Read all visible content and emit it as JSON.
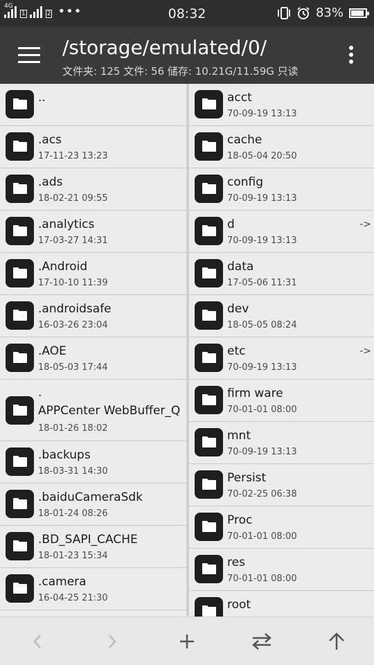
{
  "status_bar": {
    "network": "4G",
    "sim1": "1",
    "sim2": "2",
    "more": "•••",
    "time": "08:32",
    "battery": "83%",
    "battery_level": 0.83
  },
  "app_bar": {
    "title": "/storage/emulated/0/",
    "subtitle": "文件夹: 125  文件: 56  储存: 10.21G/11.59G  只读"
  },
  "left_pane": [
    {
      "name": "..",
      "date": ""
    },
    {
      "name": ".acs",
      "date": "17-11-23 13:23"
    },
    {
      "name": ".ads",
      "date": "18-02-21 09:55"
    },
    {
      "name": ".analytics",
      "date": "17-03-27 14:31"
    },
    {
      "name": ".Android",
      "date": "17-10-10 11:39"
    },
    {
      "name": ".androidsafe",
      "date": "16-03-26 23:04"
    },
    {
      "name": ".AOE",
      "date": "18-05-03 17:44"
    },
    {
      "name": ".\nAPPCenter WebBuffer_Q",
      "date": "18-01-26 18:02"
    },
    {
      "name": ".backups",
      "date": "18-03-31 14:30"
    },
    {
      "name": ".baiduCameraSdk",
      "date": "18-01-24 08:26"
    },
    {
      "name": ".BD_SAPI_CACHE",
      "date": "18-01-23 15:34"
    },
    {
      "name": ".camera",
      "date": "16-04-25 21:30"
    }
  ],
  "right_pane": [
    {
      "name": "acct",
      "date": "70-09-19 13:13",
      "link": ""
    },
    {
      "name": "cache",
      "date": "18-05-04 20:50",
      "link": ""
    },
    {
      "name": "config",
      "date": "70-09-19 13:13",
      "link": ""
    },
    {
      "name": "d",
      "date": "70-09-19 13:13",
      "link": "->"
    },
    {
      "name": "data",
      "date": "17-05-06 11:31",
      "link": ""
    },
    {
      "name": "dev",
      "date": "18-05-05 08:24",
      "link": ""
    },
    {
      "name": "etc",
      "date": "70-09-19 13:13",
      "link": "->"
    },
    {
      "name": "firm ware",
      "date": "70-01-01 08:00",
      "link": ""
    },
    {
      "name": "mnt",
      "date": "70-09-19 13:13",
      "link": ""
    },
    {
      "name": "Persist",
      "date": "70-02-25 06:38",
      "link": ""
    },
    {
      "name": "Proc",
      "date": "70-01-01 08:00",
      "link": ""
    },
    {
      "name": "res",
      "date": "70-01-01 08:00",
      "link": ""
    },
    {
      "name": "root",
      "date": "",
      "link": ""
    }
  ],
  "icons": {
    "folder": "folder-icon",
    "menu": "hamburger-menu-icon",
    "overflow": "more-vert-icon",
    "back": "chevron-left-icon",
    "forward": "chevron-right-icon",
    "add": "plus-icon",
    "swap": "swap-arrows-icon",
    "up": "arrow-up-icon"
  },
  "colors": {
    "status_bar": "#2e2e2e",
    "app_bar": "#3a3a3a",
    "folder_tile": "#1e1e1e",
    "list_bg": "#ececec"
  }
}
